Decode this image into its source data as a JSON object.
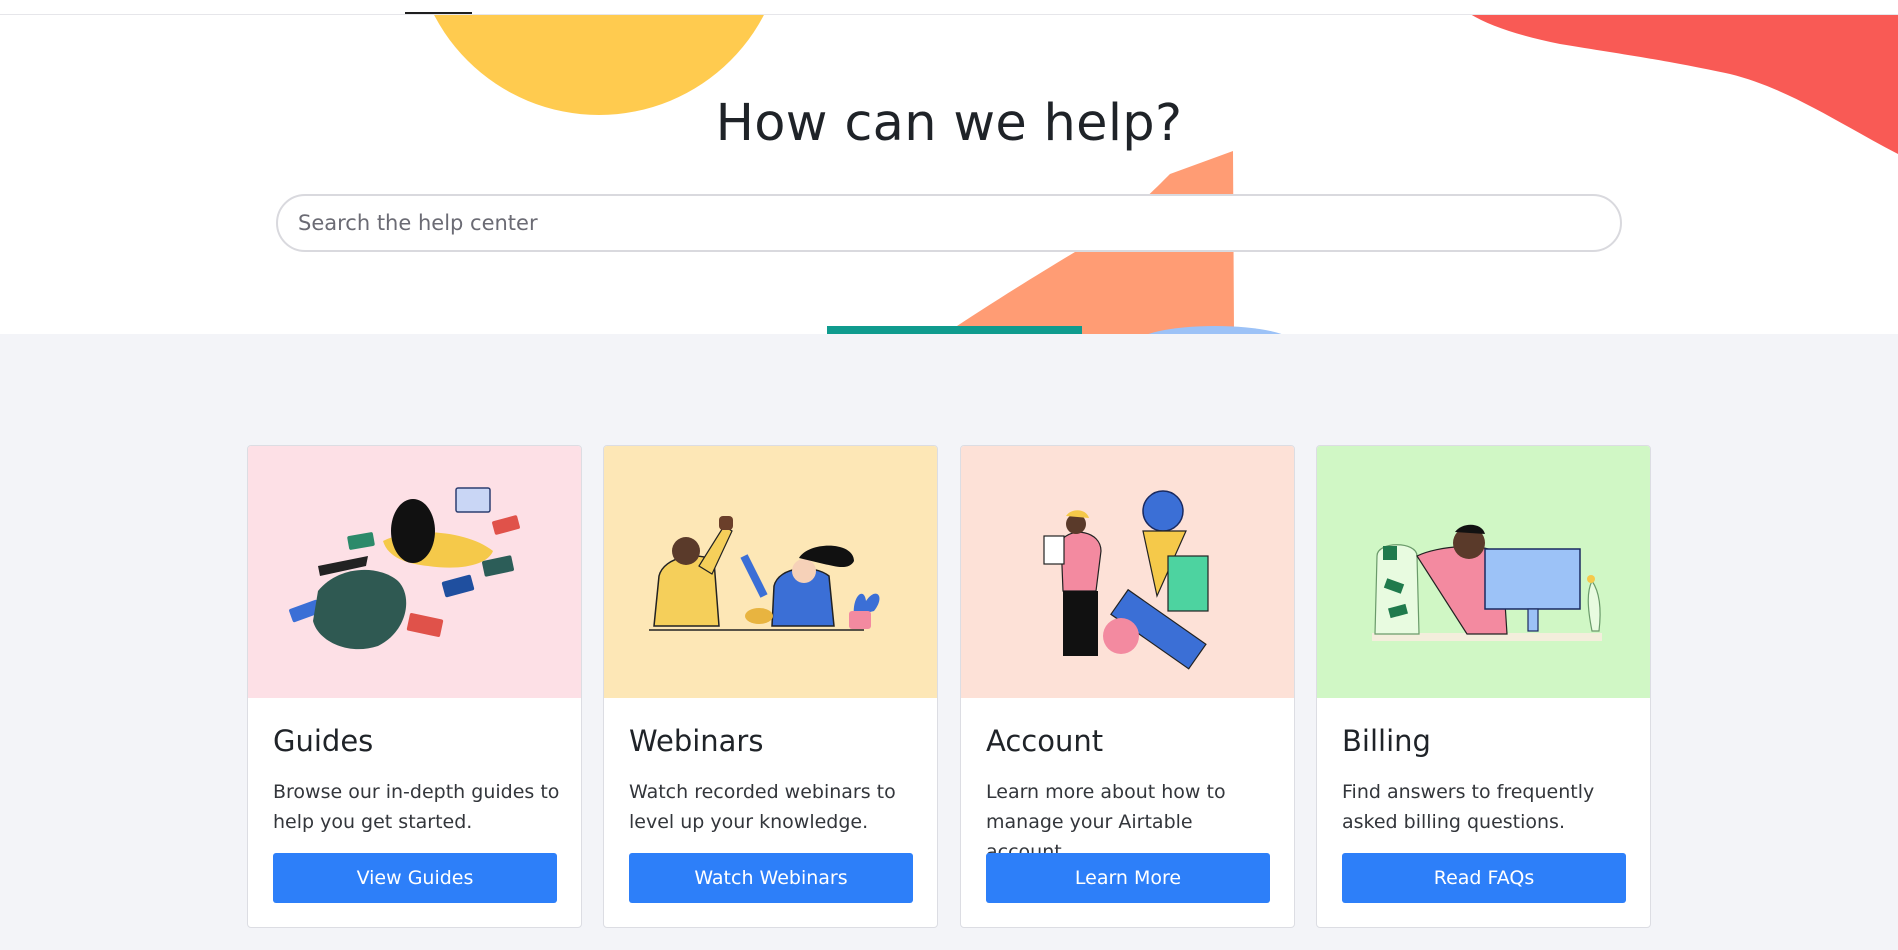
{
  "hero": {
    "title": "How can we help?",
    "search_placeholder": "Search the help center"
  },
  "colors": {
    "accent": "#2d7ff9",
    "section_bg": "#f3f4f8",
    "deco_yellow": "#ffcb4f",
    "deco_red": "#f95a55",
    "deco_peach": "#ff9c74",
    "deco_teal": "#0f9b8e",
    "deco_blue": "#9cc2f7"
  },
  "cards": [
    {
      "title": "Guides",
      "description": "Browse our in-depth guides to help you get started.",
      "button_label": "View Guides",
      "image_bg": "#fde0e6",
      "illustration": "person-reading-icon"
    },
    {
      "title": "Webinars",
      "description": "Watch recorded webinars to level up your knowledge.",
      "button_label": "Watch Webinars",
      "image_bg": "#fde7b6",
      "illustration": "people-high-five-icon"
    },
    {
      "title": "Account",
      "description": "Learn more about how to manage your Airtable account.",
      "button_label": "Learn More",
      "image_bg": "#fde1d7",
      "illustration": "person-with-shapes-icon"
    },
    {
      "title": "Billing",
      "description": "Find answers to frequently asked billing questions.",
      "button_label": "Read FAQs",
      "image_bg": "#d0f7c5",
      "illustration": "person-at-computer-icon"
    }
  ]
}
